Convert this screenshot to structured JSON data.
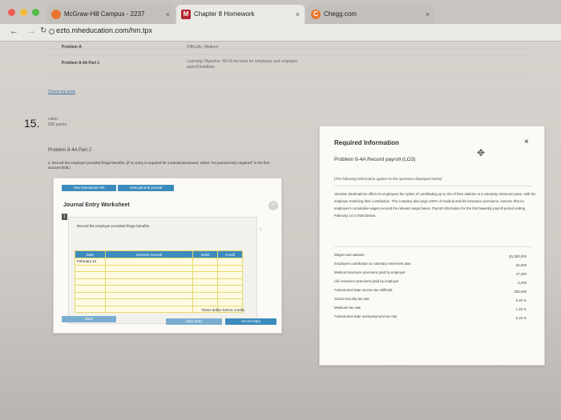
{
  "browser": {
    "tabs": [
      {
        "label": "McGraw-Hill Campus - 2237",
        "close": "×",
        "icon_color": "#e8762d"
      },
      {
        "label": "Chapter 8 Homework",
        "close": "×",
        "icon_color": "#b3262f",
        "icon_letter": "M"
      },
      {
        "label": "Chegg.com",
        "close": "×",
        "icon_color": "#e8762d",
        "icon_letter": "C"
      }
    ],
    "url": "ezto.mheducation.com/hm.tpx"
  },
  "problem_table": {
    "rows": [
      {
        "label": "Problem A",
        "detail": "Difficulty: Medium"
      },
      {
        "label": "Problem 8-4A Part 1",
        "detail": "Learning Objective: 08-03 Account for employee and employer payroll liabilities"
      }
    ],
    "check_link": "Check my work"
  },
  "question": {
    "number": "15.",
    "value_label": "value:",
    "points": "500 points",
    "part_title": "Problem 8-4A Part 2",
    "instruction": "2. Record the employer-provided fringe benefits. (If no entry is required for a transaction/event, select \"No journal entry required\" in the first account field.)"
  },
  "worksheet": {
    "buttons": {
      "view_transaction": "view transaction list",
      "view_journal": "view general journal"
    },
    "title": "Journal Entry Worksheet",
    "step": "1",
    "prompt": "Record the employer-provided fringe benefits.",
    "columns": [
      "Date",
      "General Journal",
      "Debit",
      "Credit"
    ],
    "first_date": "February 14",
    "footnote": "*Enter debits before credits",
    "done": "done",
    "clear": "clear entry",
    "record": "record entry"
  },
  "required_info": {
    "title": "Required Information",
    "close": "×",
    "subtitle": "Problem 8-4A Record payroll (LO3)",
    "note": "[The following information applies to the questions displayed below]",
    "description": "Vacation Destinations offers its employees the option of contributing up to 6% of their salaries to a voluntary retirement plan, with the employer matching their contribution. The company also pays 100% of medical and life insurance premiums. Assume that no employee's cumulative wages exceed the relevant wage bases. Payroll information for the first biweekly payroll period ending February 14 is listed below.",
    "items": [
      {
        "label": "Wages and salaries",
        "value": "$1,300,000"
      },
      {
        "label": "Employee contribution to voluntary retirement plan",
        "value": "54,600"
      },
      {
        "label": "Medical insurance premiums paid by employer",
        "value": "27,300"
      },
      {
        "label": "Life insurance premiums paid by employer",
        "value": "5,200"
      },
      {
        "label": "Federal and state income tax withheld",
        "value": "325,000"
      },
      {
        "label": "Social Security tax rate",
        "value": "6.20 %"
      },
      {
        "label": "Medicare tax rate",
        "value": "1.45 %"
      },
      {
        "label": "Federal and state unemployment tax rate",
        "value": "6.20 %"
      }
    ]
  }
}
